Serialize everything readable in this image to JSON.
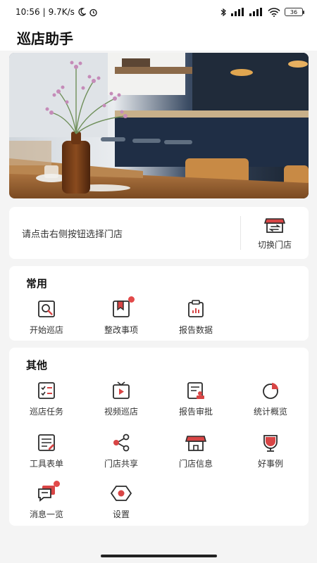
{
  "status_bar": {
    "time": "10:56",
    "net_speed": "9.7K/s",
    "battery": "36"
  },
  "app_title": "巡店助手",
  "store": {
    "prompt": "请点击右侧按钮选择门店",
    "switch_label": "切换门店"
  },
  "common": {
    "title": "常用",
    "items": [
      {
        "label": "开始巡店",
        "icon": "search-doc-icon"
      },
      {
        "label": "整改事项",
        "icon": "bookmark-doc-icon",
        "badge": true
      },
      {
        "label": "报告数据",
        "icon": "bar-report-icon"
      }
    ]
  },
  "others": {
    "title": "其他",
    "items": [
      {
        "label": "巡店任务",
        "icon": "checklist-icon"
      },
      {
        "label": "视频巡店",
        "icon": "video-icon"
      },
      {
        "label": "报告审批",
        "icon": "approval-icon"
      },
      {
        "label": "统计概览",
        "icon": "pie-chart-icon"
      },
      {
        "label": "工具表单",
        "icon": "form-icon"
      },
      {
        "label": "门店共享",
        "icon": "share-icon"
      },
      {
        "label": "门店信息",
        "icon": "store-icon"
      },
      {
        "label": "好事例",
        "icon": "trophy-icon"
      },
      {
        "label": "消息一览",
        "icon": "message-icon",
        "badge": true
      },
      {
        "label": "设置",
        "icon": "settings-icon"
      }
    ]
  },
  "colors": {
    "accent": "#d84545",
    "icon_stroke": "#2b2b2b",
    "background": "#f4f4f4"
  }
}
